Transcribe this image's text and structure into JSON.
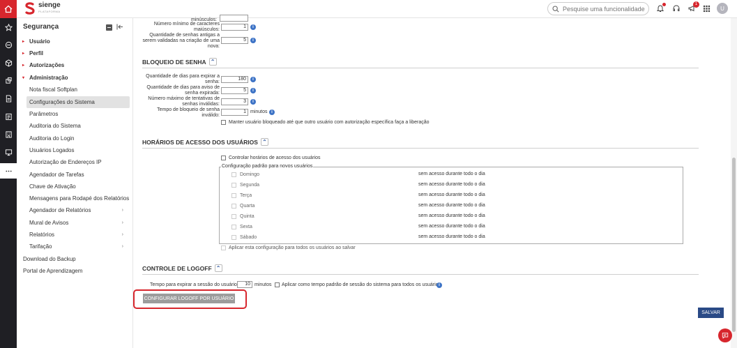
{
  "brand": {
    "name": "sienge",
    "tagline": "PLATAFORMA"
  },
  "search": {
    "placeholder": "Pesquise uma funcionalidade"
  },
  "header": {
    "notification_count": "1",
    "avatar_initial": "U"
  },
  "sidebar": {
    "title": "Segurança",
    "groups": [
      {
        "label": "Usuário"
      },
      {
        "label": "Perfil"
      },
      {
        "label": "Autorizações"
      },
      {
        "label": "Administração"
      }
    ],
    "admin_items": [
      {
        "label": "Nota fiscal Softplan"
      },
      {
        "label": "Configurações do Sistema"
      },
      {
        "label": "Parâmetros"
      },
      {
        "label": "Auditoria do Sistema"
      },
      {
        "label": "Auditoria do Login"
      },
      {
        "label": "Usuários Logados"
      },
      {
        "label": "Autorização de Endereços IP"
      },
      {
        "label": "Agendador de Tarefas"
      },
      {
        "label": "Chave de Ativação"
      },
      {
        "label": "Mensagens para Rodapé dos Relatórios"
      },
      {
        "label": "Agendador de Relatórios"
      },
      {
        "label": "Mural de Avisos"
      },
      {
        "label": "Relatórios"
      },
      {
        "label": "Tarifação"
      }
    ],
    "bottom_items": [
      {
        "label": "Download do Backup"
      },
      {
        "label": "Portal de Aprendizagem"
      }
    ]
  },
  "password_rules": {
    "partial_label": "minúsculos:",
    "min_upper_label_1": "Número mínimo de caracteres",
    "min_upper_label_2": "maiúsculos:",
    "min_upper_value": "1",
    "history_label_1": "Quantidade de senhas antigas a",
    "history_label_2": "serem validadas na criação de uma",
    "history_label_3": "nova:",
    "history_value": "5"
  },
  "lockout": {
    "title": "BLOQUEIO DE SENHA",
    "expire_label_1": "Quantidade de dias para expirar a",
    "expire_label_2": "senha:",
    "expire_value": "180",
    "warn_label_1": "Quantidade de dias para aviso de",
    "warn_label_2": "senha expirada:",
    "warn_value": "5",
    "attempts_label_1": "Número máximo de tentativas de",
    "attempts_label_2": "senhas inválidas:",
    "attempts_value": "3",
    "block_label_1": "Tempo de bloqueio de senha",
    "block_label_2": "inválido:",
    "block_value": "1",
    "block_unit": "minutos",
    "keep_blocked_label": "Manter usuário bloqueado até que outro usuário com autorização específica faça a liberação"
  },
  "access_hours": {
    "title": "HORÁRIOS DE ACESSO DOS USUÁRIOS",
    "control_label": "Controlar horários de acesso dos usuários",
    "default_legend": "Configuração padrão para novos usuários",
    "days": [
      {
        "day": "Domingo",
        "status": "sem acesso durante todo o dia"
      },
      {
        "day": "Segunda",
        "status": "sem acesso durante todo o dia"
      },
      {
        "day": "Terça",
        "status": "sem acesso durante todo o dia"
      },
      {
        "day": "Quarta",
        "status": "sem acesso durante todo o dia"
      },
      {
        "day": "Quinta",
        "status": "sem acesso durante todo o dia"
      },
      {
        "day": "Sexta",
        "status": "sem acesso durante todo o dia"
      },
      {
        "day": "Sábado",
        "status": "sem acesso durante todo o dia"
      }
    ],
    "apply_all_label": "Aplicar esta configuração para todos os usuários ao salvar"
  },
  "logoff": {
    "title": "CONTROLE DE LOGOFF",
    "session_label": "Tempo para expirar a sessão do usuário*:",
    "session_value": "10",
    "session_unit": "minutos",
    "apply_default_label": "Aplicar como tempo padrão de sessão do sistema para todos os usuários",
    "configure_button": "CONFIGURAR LOGOFF POR USUÁRIO"
  },
  "save_button": "SALVAR",
  "colors": {
    "brand_red": "#d7262d",
    "navy": "#2a4a86",
    "info_blue": "#3d73c6"
  }
}
